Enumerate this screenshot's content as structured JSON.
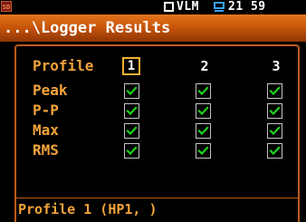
{
  "status_bar": {
    "sd_label": "SD",
    "mode": "VLM",
    "time": "21 59"
  },
  "title": "...\\Logger Results",
  "table": {
    "header_label": "Profile",
    "columns": [
      "1",
      "2",
      "3"
    ],
    "selected_column": "1",
    "rows": [
      {
        "label": "Peak",
        "checked": [
          true,
          true,
          true
        ]
      },
      {
        "label": "P-P",
        "checked": [
          true,
          true,
          true
        ]
      },
      {
        "label": "Max",
        "checked": [
          true,
          true,
          true
        ]
      },
      {
        "label": "RMS",
        "checked": [
          true,
          true,
          true
        ]
      }
    ]
  },
  "footer": "Profile 1 (HP1, )",
  "colors": {
    "accent": "#c45309",
    "label": "#f2a33a",
    "check": "#1fd11f",
    "selection": "#f5b035"
  }
}
